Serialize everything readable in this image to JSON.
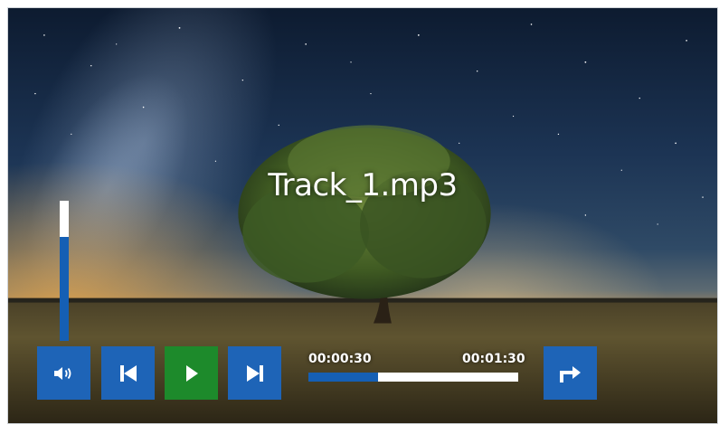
{
  "player": {
    "track_name": "Track_1.mp3",
    "current_time": "00:00:30",
    "total_time": "00:01:30",
    "progress": 0.33,
    "volume": 0.74
  },
  "controls": [
    {
      "name": "volume-button",
      "icon": "speaker-icon"
    },
    {
      "name": "previous-button",
      "icon": "skip-back-icon"
    },
    {
      "name": "play-button",
      "icon": "play-icon"
    },
    {
      "name": "next-button",
      "icon": "skip-forward-icon"
    },
    {
      "name": "share-button",
      "icon": "share-arrow-icon"
    }
  ],
  "colors": {
    "button_blue": "#1e64b7",
    "play_green": "#1d8a2b",
    "slider_fill": "#155fb4",
    "slider_track": "#ffffff"
  }
}
